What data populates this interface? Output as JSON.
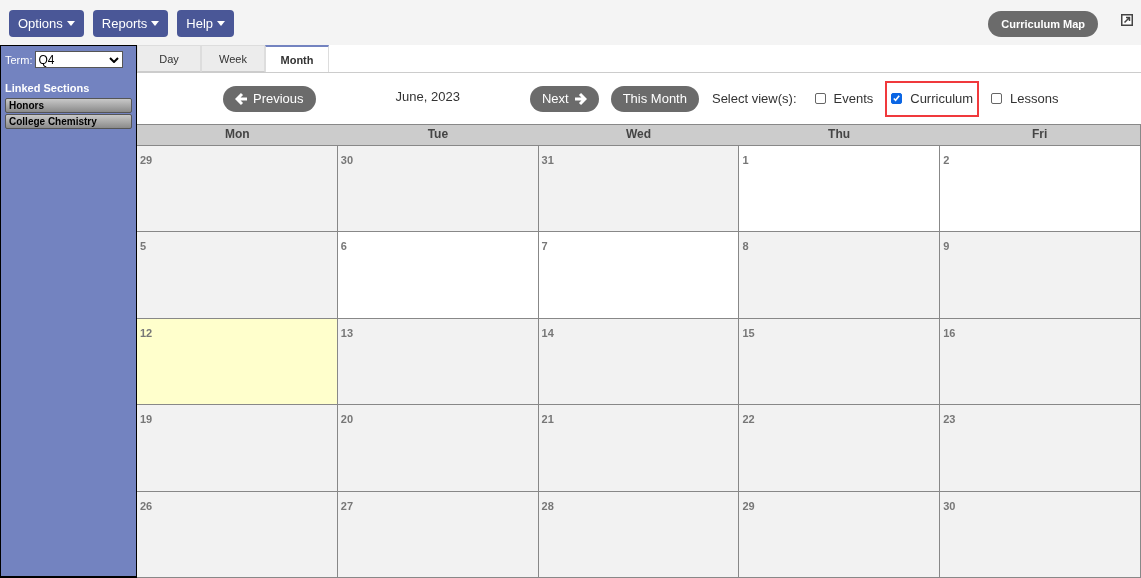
{
  "menu": [
    {
      "label": "Options"
    },
    {
      "label": "Reports"
    },
    {
      "label": "Help"
    }
  ],
  "curriculum_map_button": "Curriculum Map",
  "sidebar": {
    "term_label": "Term:",
    "term_value": "Q4",
    "linked_sections_title": "Linked Sections",
    "sections": [
      "Honors",
      "College Chemistry"
    ]
  },
  "tabs": [
    {
      "label": "Day",
      "selected": false
    },
    {
      "label": "Week",
      "selected": false
    },
    {
      "label": "Month",
      "selected": true
    }
  ],
  "nav": {
    "previous": "Previous",
    "period": "June, 2023",
    "next": "Next",
    "this_month": "This Month",
    "select_label": "Select view(s):"
  },
  "views": [
    {
      "label": "Events",
      "checked": false,
      "highlighted": false
    },
    {
      "label": "Curriculum",
      "checked": true,
      "highlighted": true
    },
    {
      "label": "Lessons",
      "checked": false,
      "highlighted": false
    }
  ],
  "weekdays": [
    "Mon",
    "Tue",
    "Wed",
    "Thu",
    "Fri"
  ],
  "weeks": [
    [
      {
        "day": "29",
        "kind": "grey"
      },
      {
        "day": "30",
        "kind": "grey"
      },
      {
        "day": "31",
        "kind": "grey"
      },
      {
        "day": "1",
        "kind": "plain"
      },
      {
        "day": "2",
        "kind": "plain"
      }
    ],
    [
      {
        "day": "5",
        "kind": "grey"
      },
      {
        "day": "6",
        "kind": "plain"
      },
      {
        "day": "7",
        "kind": "plain"
      },
      {
        "day": "8",
        "kind": "grey"
      },
      {
        "day": "9",
        "kind": "grey"
      }
    ],
    [
      {
        "day": "12",
        "kind": "today"
      },
      {
        "day": "13",
        "kind": "grey"
      },
      {
        "day": "14",
        "kind": "grey"
      },
      {
        "day": "15",
        "kind": "grey"
      },
      {
        "day": "16",
        "kind": "grey"
      }
    ],
    [
      {
        "day": "19",
        "kind": "grey"
      },
      {
        "day": "20",
        "kind": "grey"
      },
      {
        "day": "21",
        "kind": "grey"
      },
      {
        "day": "22",
        "kind": "grey"
      },
      {
        "day": "23",
        "kind": "grey"
      }
    ],
    [
      {
        "day": "26",
        "kind": "grey"
      },
      {
        "day": "27",
        "kind": "grey"
      },
      {
        "day": "28",
        "kind": "grey"
      },
      {
        "day": "29",
        "kind": "grey"
      },
      {
        "day": "30",
        "kind": "grey"
      }
    ]
  ]
}
